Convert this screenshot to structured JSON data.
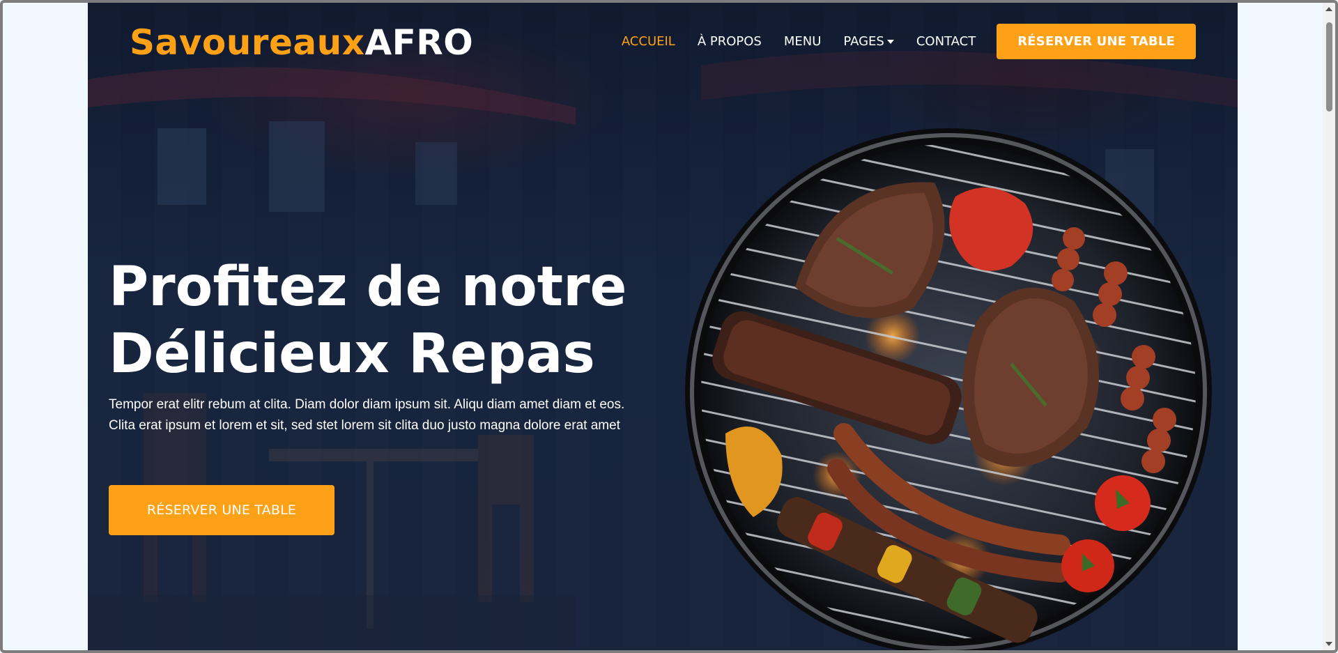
{
  "brand": {
    "part1": "Savoureaux",
    "part2": "AFRO"
  },
  "nav": {
    "items": [
      {
        "label": "ACCUEIL",
        "active": true
      },
      {
        "label": "À PROPOS",
        "active": false
      },
      {
        "label": "MENU",
        "active": false
      },
      {
        "label": "PAGES",
        "active": false,
        "dropdown": true
      },
      {
        "label": "CONTACT",
        "active": false
      }
    ],
    "cta_label": "RÉSERVER UNE TABLE"
  },
  "hero": {
    "title_line1": "Profitez de notre",
    "title_line2": "Délicieux Repas",
    "text": "Tempor erat elitr rebum at clita. Diam dolor diam ipsum sit. Aliqu diam amet diam et eos. Clita erat ipsum et lorem et sit, sed stet lorem sit clita duo justo magna dolore erat amet",
    "cta_label": "RÉSERVER UNE TABLE"
  },
  "colors": {
    "accent": "#fea116",
    "dark": "#0f172b",
    "page_bg": "#f1f8ff"
  },
  "icons": {
    "grill": "bbq-grill-image",
    "dropdown": "caret-down-icon"
  }
}
